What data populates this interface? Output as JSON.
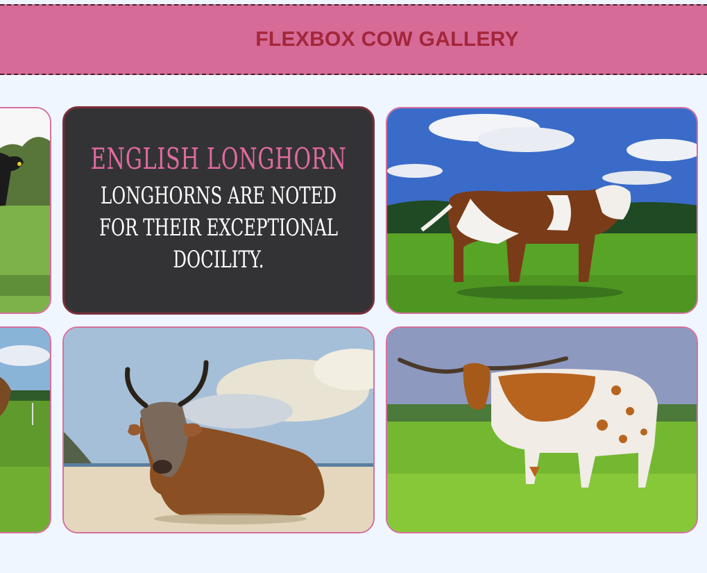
{
  "header": {
    "title": "FLEXBOX COW GALLERY"
  },
  "cards": [
    {
      "type": "image",
      "icon": "black-cow-pasture-image"
    },
    {
      "type": "info",
      "title": "English Longhorn",
      "description": "Longhorns are noted for their exceptional docility."
    },
    {
      "type": "image",
      "icon": "brown-white-cow-field-image"
    },
    {
      "type": "image",
      "icon": "cow-green-field-image"
    },
    {
      "type": "image",
      "icon": "zebu-on-beach-image"
    },
    {
      "type": "image",
      "icon": "texas-longhorn-grass-image"
    }
  ],
  "colors": {
    "page_bg": "#f0f6ff",
    "header_bg": "#d66b97",
    "header_text": "#a3263a",
    "card_border": "#d46fa0",
    "info_bg": "#333335",
    "info_title": "#e06aa0",
    "info_text": "#ffffff"
  }
}
